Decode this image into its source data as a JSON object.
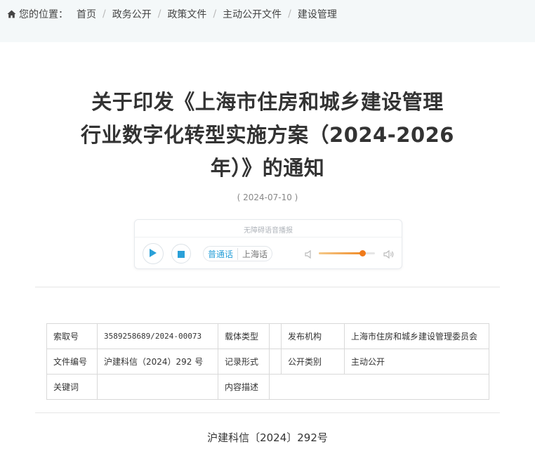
{
  "breadcrumb": {
    "lead": "您的位置：",
    "items": [
      "首页",
      "政务公开",
      "政策文件",
      "主动公开文件",
      "建设管理"
    ]
  },
  "article": {
    "title_lines": [
      "关于印发《上海市住房和城乡建设管理",
      "行业数字化转型实施方案（2024-2026",
      "年）》的通知"
    ],
    "date": "( 2024-07-10 )"
  },
  "player": {
    "title": "无障碍语音播报",
    "lang_active": "普通话",
    "lang_other": "上海话",
    "volume": 0.78,
    "accent_color": "#2aa0d8",
    "slider_color": "#f07a1a",
    "icons": [
      "play-icon",
      "stop-icon",
      "volume-low-icon",
      "volume-high-icon"
    ]
  },
  "meta": {
    "row1": {
      "l1": "索取号",
      "v1": "3589258689/2024-00073",
      "l2": "载体类型",
      "v2": "",
      "l3": "发布机构",
      "v3": "上海市住房和城乡建设管理委员会"
    },
    "row2": {
      "l1": "文件编号",
      "v1": "沪建科信（2024）292 号",
      "l2": "记录形式",
      "v2": "",
      "l3": "公开类别",
      "v3": "主动公开"
    },
    "row3": {
      "l1": "关键词",
      "v1": "",
      "l2": "内容描述",
      "v2": ""
    }
  },
  "body": {
    "doc_no": "沪建科信〔2024〕292号"
  }
}
